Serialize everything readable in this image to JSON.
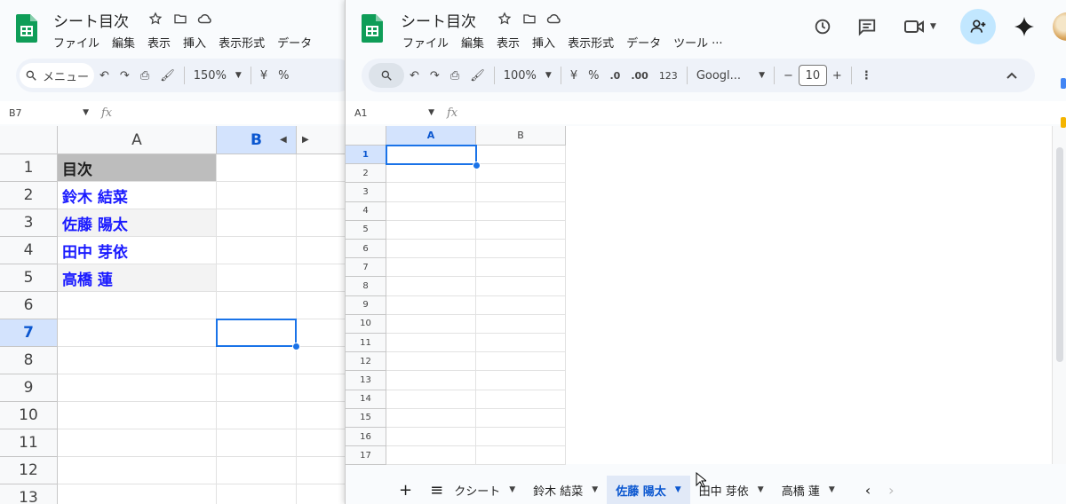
{
  "left_window": {
    "title": "シート目次",
    "menu": [
      "ファイル",
      "編集",
      "表示",
      "挿入",
      "表示形式",
      "データ"
    ],
    "toolbar": {
      "menu_search": "メニュー",
      "zoom": "150%",
      "currency": "¥",
      "percent": "%"
    },
    "name_box": "B7",
    "fx": "fx",
    "columns": [
      "A",
      "B"
    ],
    "rows": [
      "1",
      "2",
      "3",
      "4",
      "5",
      "6",
      "7",
      "8",
      "9",
      "10",
      "11",
      "12",
      "13"
    ],
    "cells_a": [
      "目次",
      "鈴木 結菜",
      "佐藤 陽太",
      "田中 芽依",
      "高橋 蓮",
      "",
      "",
      "",
      "",
      "",
      "",
      "",
      ""
    ],
    "selected_cell": "B7"
  },
  "right_window": {
    "title": "シート目次",
    "menu": [
      "ファイル",
      "編集",
      "表示",
      "挿入",
      "表示形式",
      "データ",
      "ツール",
      "..."
    ],
    "toolbar": {
      "zoom": "100%",
      "currency": "¥",
      "percent": "%",
      "decimal_decrease": ".0",
      "decimal_increase": ".00",
      "number_format": "123",
      "font": "Googl...",
      "font_size": "10",
      "minus": "−",
      "plus": "+"
    },
    "name_box": "A1",
    "fx": "fx",
    "columns": [
      "A",
      "B"
    ],
    "rows": [
      "1",
      "2",
      "3",
      "4",
      "5",
      "6",
      "7",
      "8",
      "9",
      "10",
      "11",
      "12",
      "13",
      "14",
      "15",
      "16",
      "17"
    ],
    "selected_cell": "A1",
    "tabs": [
      {
        "label": "クシート",
        "active": false
      },
      {
        "label": "鈴木 結菜",
        "active": false
      },
      {
        "label": "佐藤 陽太",
        "active": true
      },
      {
        "label": "田中 芽依",
        "active": false
      },
      {
        "label": "高橋 蓮",
        "active": false
      }
    ]
  },
  "colors": {
    "accent": "#1a73e8",
    "link_blue": "#1a1aff",
    "sheets_green": "#0f9d58",
    "header_gray": "#bdbdbd"
  }
}
